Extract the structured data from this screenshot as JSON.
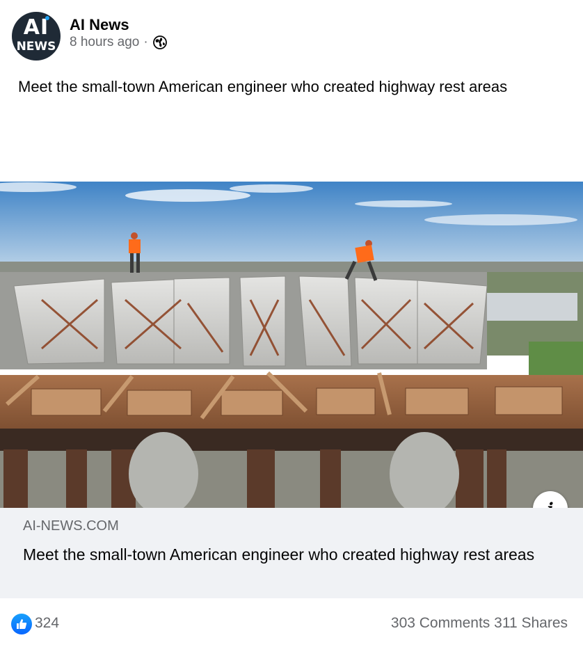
{
  "page": {
    "name": "AI News",
    "avatar_line1": "AI",
    "avatar_line2": "NEWS",
    "timestamp": "8 hours ago",
    "separator": "·",
    "privacy_icon": "globe-icon"
  },
  "post": {
    "text": "Meet the small-town American engineer who created highway rest areas"
  },
  "link_preview": {
    "image_alt": "Workers on concrete highway bridge girders under construction",
    "domain": "AI-NEWS.COM",
    "title": "Meet the small-town American engineer who created highway rest areas",
    "info_icon": "info-icon",
    "info_label": "i"
  },
  "engagement": {
    "reaction_icon": "like-icon",
    "reactions_count": "324",
    "comments": "303 Comments",
    "shares": "311 Shares"
  },
  "colors": {
    "primary_text": "#050505",
    "secondary_text": "#65676b",
    "like_blue": "#0866ff",
    "card_background": "#f0f2f5"
  }
}
